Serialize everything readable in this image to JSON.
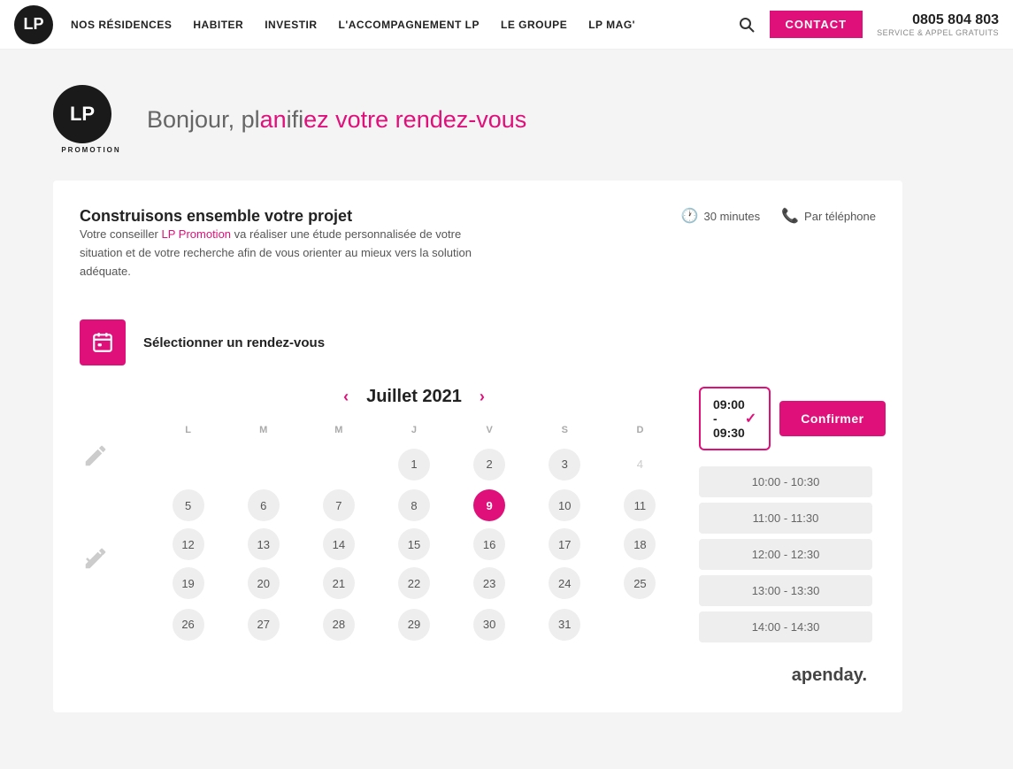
{
  "nav": {
    "logo": "LP",
    "logo_sub": "PROMOTION",
    "links": [
      {
        "label": "NOS RÉSIDENCES"
      },
      {
        "label": "HABITER"
      },
      {
        "label": "INVESTIR"
      },
      {
        "label": "L'ACCOMPAGNEMENT LP"
      },
      {
        "label": "LE GROUPE"
      },
      {
        "label": "LP MAG'"
      }
    ],
    "contact_label": "CONTACT",
    "phone": "0805 804 803",
    "phone_sub": "SERVICE & APPEL GRATUITS"
  },
  "header": {
    "greeting": "Bonjour, pl",
    "greeting_accent1": "an",
    "greeting_mid": "ifi",
    "greeting_accent2": "ez votre rendez-vous"
  },
  "card": {
    "title": "Construisons ensemble votre projet",
    "meta_duration": "30 minutes",
    "meta_type": "Par téléphone",
    "desc_normal1": "Votre conseiller ",
    "desc_link": "LP Promotion",
    "desc_normal2": " va réaliser une étude personnalisée de votre situation et de votre recherche afin de vous orienter au mieux vers la solution adéquate.",
    "step_label": "Sélectionner un rendez-vous"
  },
  "calendar": {
    "month": "Juillet 2021",
    "days_header": [
      "L",
      "M",
      "M",
      "J",
      "V",
      "S",
      "D"
    ],
    "rows": [
      [
        null,
        null,
        null,
        1,
        2,
        3,
        4
      ],
      [
        5,
        6,
        7,
        8,
        9,
        10,
        11
      ],
      [
        12,
        13,
        14,
        15,
        16,
        17,
        18
      ],
      [
        19,
        20,
        21,
        22,
        23,
        24,
        25
      ],
      [
        26,
        27,
        28,
        29,
        30,
        31,
        null
      ]
    ],
    "selected_day": 9,
    "available_days": [
      1,
      2,
      3,
      5,
      6,
      7,
      8,
      9,
      10,
      11,
      12,
      13,
      14,
      15,
      16,
      17,
      18,
      19,
      20,
      21,
      22,
      23,
      24,
      25,
      26,
      27,
      28,
      29,
      30,
      31
    ]
  },
  "timeslots": {
    "selected": "09:00 - 09:30",
    "confirm_label": "Confirmer",
    "slots": [
      "10:00 - 10:30",
      "11:00 - 11:30",
      "12:00 - 12:30",
      "13:00 - 13:30",
      "14:00 - 14:30"
    ]
  },
  "apenday": {
    "brand": "apenday"
  }
}
